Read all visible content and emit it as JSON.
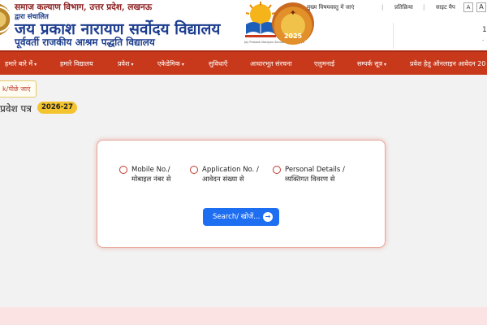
{
  "header": {
    "org_line1": "समाज कल्याण विभाग, उत्तर प्रदेश, लखनऊ",
    "org_line2": "द्वारा संचालित",
    "title": "जय प्रकाश नारायण सर्वोदय विद्यालय",
    "subtitle": "पूर्ववर्ती राजकीय आश्रम पद्धति विद्यालय",
    "badge_year": "2025",
    "right_number": "1"
  },
  "toplinks": {
    "main_content": "मुख्य विषयवस्तु में जाएं",
    "feedback": "प्रतिक्रिया",
    "sitemap": "साइट मैप",
    "font_small": "A",
    "font_large": "A"
  },
  "nav": {
    "items": [
      {
        "label": "हमारे बारे में",
        "dropdown": true
      },
      {
        "label": "हमारे विद्यालय",
        "dropdown": false
      },
      {
        "label": "प्रवेश",
        "dropdown": true
      },
      {
        "label": "एकेडेमिक",
        "dropdown": true
      },
      {
        "label": "सुविधाएँ",
        "dropdown": false
      },
      {
        "label": "आधारभूत संरचना",
        "dropdown": false
      },
      {
        "label": "एलुमनाई",
        "dropdown": false
      },
      {
        "label": "सम्पर्क सूत्र",
        "dropdown": true
      },
      {
        "label": "प्रवेश हेतु ऑनलाइन आवेदन 20",
        "dropdown": false
      }
    ],
    "caret": "▾"
  },
  "main": {
    "back_link": "k/पीछे जाएं",
    "page_title": "प्रवेश पत्र",
    "year_badge": "2026-27"
  },
  "search": {
    "options": [
      {
        "line1": "Mobile No./",
        "line2": "मोबाइल नंबर से"
      },
      {
        "line1": "Application No. /",
        "line2": "आवेदन संख्या से"
      },
      {
        "line1": "Personal Details /",
        "line2": "व्यक्तिगत विवरण से"
      }
    ],
    "button_label": "Search/ खोजें...",
    "button_icon": "→"
  },
  "colors": {
    "navbar": "#c8391b",
    "accent_blue": "#1e6ef2",
    "badge_yellow": "#f4c430",
    "title_blue": "#1d3d8f",
    "card_border": "#e9a89a",
    "footer_band": "#fbe3e3"
  }
}
